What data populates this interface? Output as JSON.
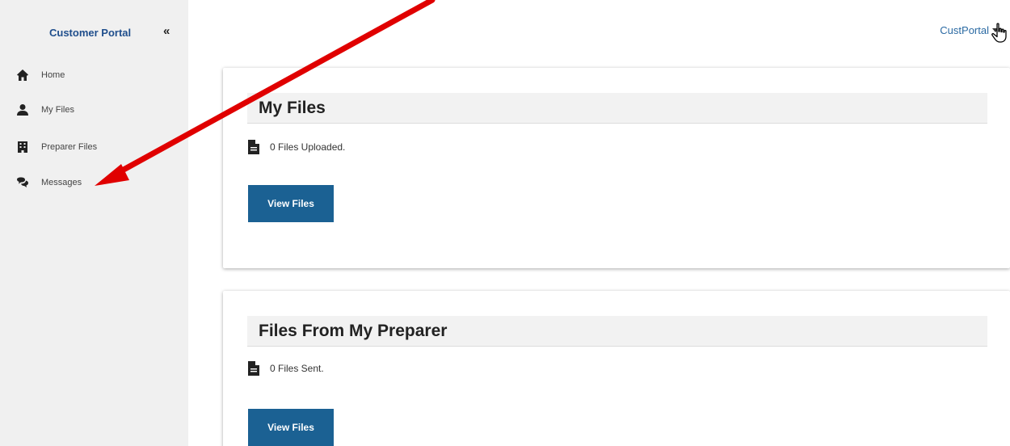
{
  "sidebar": {
    "brand": "Customer Portal",
    "collapse_label": "«",
    "items": [
      {
        "label": "Home",
        "icon": "home-icon"
      },
      {
        "label": "My Files",
        "icon": "user-icon"
      },
      {
        "label": "Preparer Files",
        "icon": "building-icon"
      },
      {
        "label": "Messages",
        "icon": "comments-icon"
      }
    ]
  },
  "header": {
    "user": "CustPortal"
  },
  "cards": [
    {
      "title": "My Files",
      "status": "0 Files Uploaded.",
      "button": "View Files"
    },
    {
      "title": "Files From My Preparer",
      "status": "0 Files Sent.",
      "button": "View Files"
    }
  ],
  "colors": {
    "accent": "#1b6193",
    "brand": "#1f4e8c",
    "arrow": "#e00000",
    "sidebar_bg": "#f0f0f0"
  }
}
